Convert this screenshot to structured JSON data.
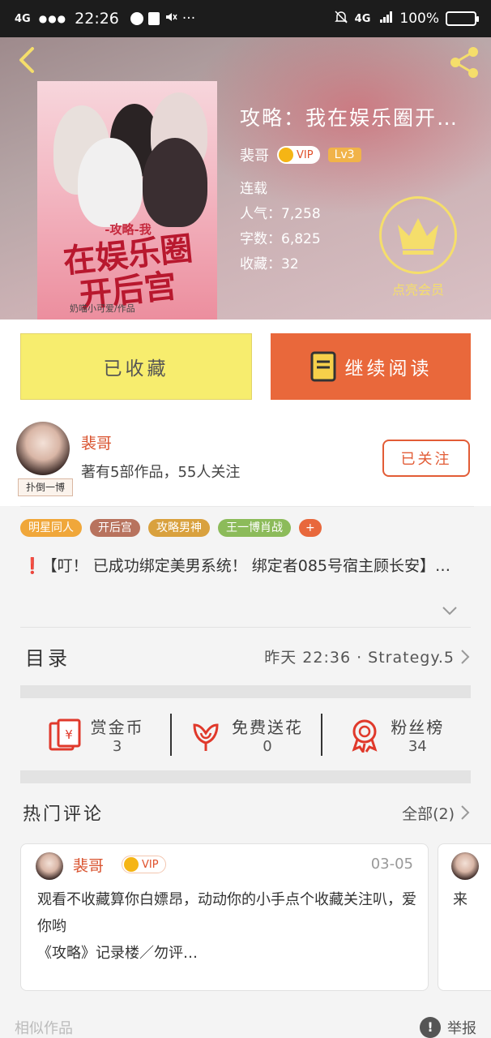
{
  "status_bar": {
    "signal_left": "4G",
    "time": "22:26",
    "signal_right": "4G",
    "battery": "100%"
  },
  "book": {
    "title": "攻略：我在娱乐圈开…",
    "author": "裴哥",
    "vip_label": "VIP",
    "level": "Lv3",
    "status": "连载",
    "popularity_label": "人气：",
    "popularity": "7,258",
    "word_count_label": "字数：",
    "word_count": "6,825",
    "favorites_label": "收藏：",
    "favorites": "32",
    "cover": {
      "small_text": "-攻略-我",
      "title_line1": "在娱乐圈",
      "title_line2": "开后宫",
      "author_credit": "奶喵小可爱/作品"
    },
    "vip_promo": "点亮会员"
  },
  "actions": {
    "collected_label": "已收藏",
    "continue_label": "继续阅读"
  },
  "author_card": {
    "name": "裴哥",
    "stats": "著有5部作品，55人关注",
    "avatar_tag": "扑倒一博",
    "follow_label": "已关注"
  },
  "tags": [
    {
      "label": "明星同人",
      "color": "#f0a73a"
    },
    {
      "label": "开后宫",
      "color": "#b8735e"
    },
    {
      "label": "攻略男神",
      "color": "#d9a13e"
    },
    {
      "label": "王一博肖战",
      "color": "#8cbb5a"
    },
    {
      "label": "+",
      "color": "#e8683c"
    }
  ],
  "summary": "【叮！ 已成功绑定美男系统！ 绑定者085号宿主顾长安】…",
  "catalog": {
    "title": "目录",
    "update": "昨天 22:36 · Strategy.5"
  },
  "stats": [
    {
      "label": "赏金币",
      "value": "3",
      "icon": "red-envelope-icon"
    },
    {
      "label": "免费送花",
      "value": "0",
      "icon": "flower-icon"
    },
    {
      "label": "粉丝榜",
      "value": "34",
      "icon": "medal-icon"
    }
  ],
  "hot_comments": {
    "title": "热门评论",
    "all_label": "全部(2)",
    "items": [
      {
        "name": "裴哥",
        "vip": "VIP",
        "date": "03-05",
        "text": "观看不收藏算你白嫖昂，动动你的小手点个收藏关注叭，爱你哟\n《攻略》记录楼／勿评…"
      },
      {
        "text_peek": "来"
      }
    ]
  },
  "footer": {
    "similar_works": "相似作品",
    "report": "举报"
  },
  "colors": {
    "accent_orange": "#e9683b",
    "collected_yellow": "#f7ed6e",
    "author_red": "#d9532f",
    "vip_gold": "#f5de6b"
  }
}
